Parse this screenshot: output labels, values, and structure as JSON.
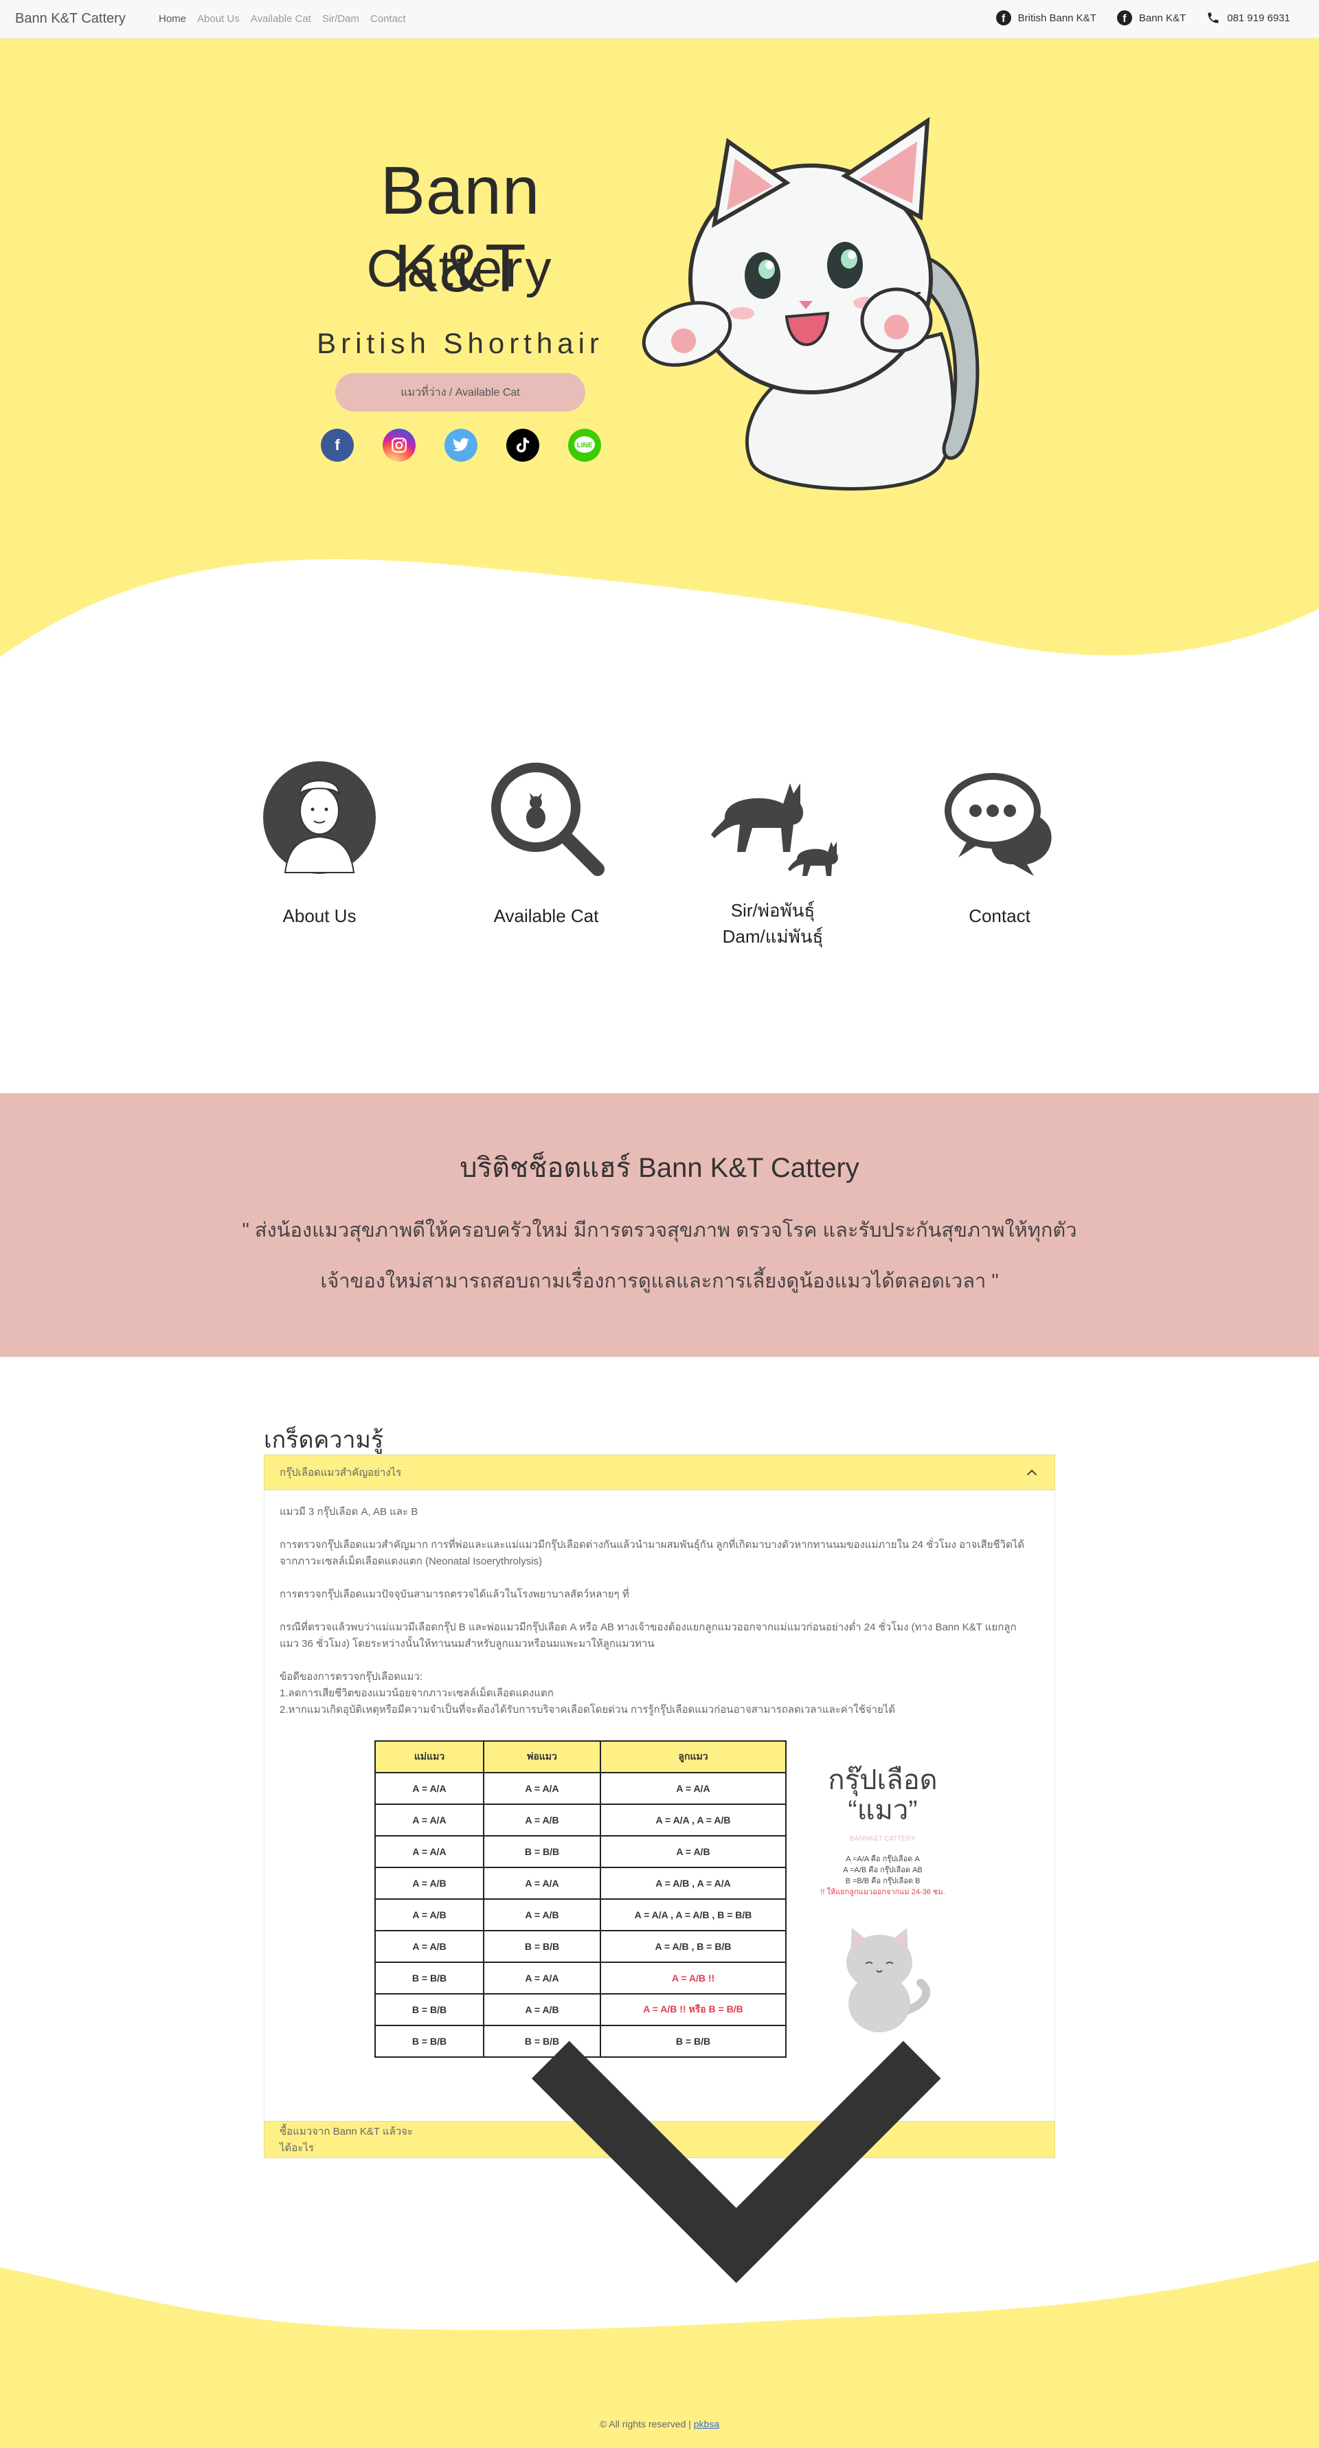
{
  "navbar": {
    "brand": "Bann K&T Cattery",
    "links": [
      "Home",
      "About Us",
      "Available Cat",
      "Sir/Dam",
      "Contact"
    ],
    "right": {
      "facebook_1": "British Bann K&T",
      "facebook_2": "Bann K&T",
      "phone": "081 919 6931"
    }
  },
  "hero": {
    "title_line1": "Bann K&T",
    "title_line2": "Cattery",
    "subtitle": "British Shorthair",
    "button": "แมวที่ว่าง / Available Cat",
    "socials": [
      "facebook-icon",
      "instagram-icon",
      "twitter-icon",
      "tiktok-icon",
      "line-icon"
    ],
    "colors": {
      "background": "#fff086",
      "button": "#e8bcb7"
    }
  },
  "features": [
    {
      "label": "About Us",
      "icon": "chef-avatar-icon"
    },
    {
      "label": "Available Cat",
      "icon": "search-cat-icon"
    },
    {
      "label_line1": "Sir/พ่อพันธุ์",
      "label_line2": "Dam/แม่พันธุ์",
      "icon": "cats-icon"
    },
    {
      "label": "Contact",
      "icon": "chat-icon"
    }
  ],
  "about": {
    "title": "บริติชช็อตแฮร์ Bann K&T Cattery",
    "line1": "\" ส่งน้องแมวสุขภาพดีให้ครอบครัวใหม่ มีการตรวจสุขภาพ ตรวจโรค และรับประกันสุขภาพให้ทุกตัว",
    "line2": "เจ้าของใหม่สามารถสอบถามเรื่องการดูแลและการเลี้ยงดูน้องแมวได้ตลอดเวลา \""
  },
  "knowledge": {
    "title": "เกร็ดความรู้",
    "item1": {
      "header": "กรุ๊ปเลือดแมวสำคัญอย่างไร",
      "p1": "แมวมี 3 กรุ๊ปเลือด A, AB และ B",
      "p2": "การตรวจกรุ๊ปเลือดแมวสำคัญมาก การที่พ่อและและแม่แมวมีกรุ๊ปเลือดต่างกันแล้วนำมาผสมพันธุ์กัน ลูกที่เกิดมาบางตัวหากทานนมของแม่ภายใน 24 ชั่วโมง อาจเสียชีวิตได้จากภาวะเซลล์เม็ดเลือดแดงแตก (Neonatal Isoerythrolysis)",
      "p3": "การตรวจกรุ๊ปเลือดแมวปัจจุบันสามารถตรวจได้แล้วในโรงพยาบาลสัตว์หลายๆ ที่",
      "p4": "กรณีที่ตรวจแล้วพบว่าแม่แมวมีเลือดกรุ๊ป B และพ่อแมวมีกรุ๊ปเลือด A หรือ AB ทางเจ้าของต้องแยกลูกแมวออกจากแม่แมวก่อนอย่างต่ำ 24 ชั่วโมง (ทาง Bann K&T แยกลูกแมว 36 ชั่วโมง) โดยระหว่างนั้นให้ทานนมสำหรับลูกแมวหรือนมแพะมาให้ลูกแมวทาน",
      "p5": "ข้อดีของการตรวจกรุ๊ปเลือดแมว:",
      "p6": "1.ลดการเสียชีวิตของแมวน้อยจากภาวะเซลล์เม็ดเลือดแดงแตก",
      "p7": "2.หากแมวเกิดอุบัติเหตุหรือมีความจำเป็นที่จะต้องได้รับการบริจาคเลือดโดยด่วน การรู้กรุ๊ปเลือดแมวก่อนอาจสามารถลดเวลาและค่าใช้จ่ายได้",
      "table": {
        "headers": [
          "แม่แมว",
          "พ่อแมว",
          "ลูกแมว"
        ],
        "rows": [
          [
            "A = A/A",
            "A = A/A",
            "A = A/A"
          ],
          [
            "A = A/A",
            "A = A/B",
            "A = A/A , A = A/B"
          ],
          [
            "A = A/A",
            "B = B/B",
            "A = A/B"
          ],
          [
            "A = A/B",
            "A = A/A",
            "A = A/B , A = A/A"
          ],
          [
            "A = A/B",
            "A = A/B",
            "A = A/A , A = A/B , B = B/B"
          ],
          [
            "A = A/B",
            "B = B/B",
            "A = A/B , B = B/B"
          ],
          [
            "B = B/B",
            "A = A/A",
            "A = A/B !!"
          ],
          [
            "B = B/B",
            "A = A/B",
            "A = A/B !! หรือ  B = B/B"
          ],
          [
            "B = B/B",
            "B = B/B",
            "B = B/B"
          ]
        ]
      },
      "poster": {
        "title1": "กรุ๊ปเลือด",
        "title2": "“แมว”",
        "brand": "BANNK&T CATTERY",
        "l1": "A =A/A คือ กรุ๊ปเลือด A",
        "l2": "A =A/B คือ กรุ๊ปเลือด AB",
        "l3": "B =B/B คือ กรุ๊ปเลือด B",
        "note": "!! ให้แยกลูกแมวออกจากแม่ 24-36 ชม."
      }
    },
    "item2": {
      "header": "ซื้อแมวจาก Bann K&T แล้วจะได้อะไร"
    }
  },
  "footer": {
    "copyright": "© All rights reserved | ",
    "link": "pkbsa",
    "color": "#fff086"
  }
}
